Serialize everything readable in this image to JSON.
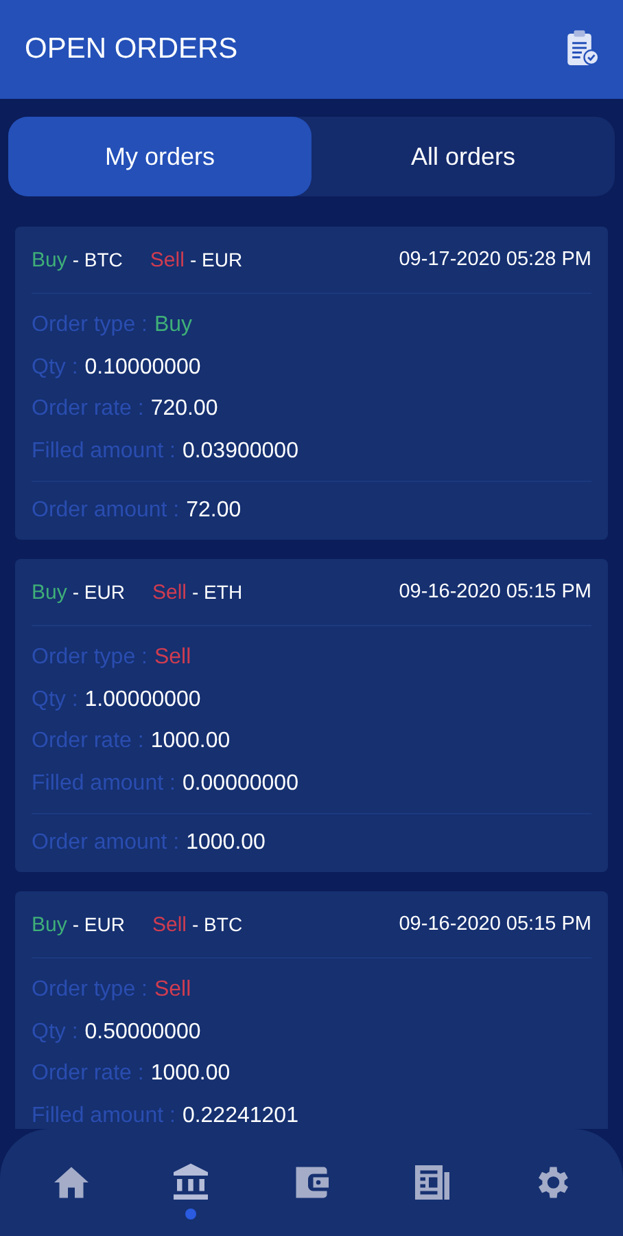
{
  "header": {
    "title": "OPEN ORDERS"
  },
  "tabs": [
    {
      "label": "My orders",
      "selected": true
    },
    {
      "label": "All orders",
      "selected": false
    }
  ],
  "orders": [
    {
      "buy_label": "Buy",
      "buy_currency": "- BTC",
      "sell_label": "Sell",
      "sell_currency": "- EUR",
      "date": "09-17-2020 05:28 PM",
      "rows": [
        {
          "label": "Order type :",
          "value": "Buy",
          "kind": "buy"
        },
        {
          "label": "Qty :",
          "value": "0.10000000",
          "kind": "plain"
        },
        {
          "label": "Order rate :",
          "value": "720.00",
          "kind": "plain"
        },
        {
          "label": "Filled amount :",
          "value": "0.03900000",
          "kind": "plain"
        }
      ],
      "total": {
        "label": "Order amount :",
        "value": "72.00"
      }
    },
    {
      "buy_label": "Buy",
      "buy_currency": "- EUR",
      "sell_label": "Sell",
      "sell_currency": "- ETH",
      "date": "09-16-2020 05:15 PM",
      "rows": [
        {
          "label": "Order type :",
          "value": "Sell",
          "kind": "sell"
        },
        {
          "label": "Qty :",
          "value": "1.00000000",
          "kind": "plain"
        },
        {
          "label": "Order rate :",
          "value": "1000.00",
          "kind": "plain"
        },
        {
          "label": "Filled amount :",
          "value": "0.00000000",
          "kind": "plain"
        }
      ],
      "total": {
        "label": "Order amount :",
        "value": "1000.00"
      }
    },
    {
      "buy_label": "Buy",
      "buy_currency": "- EUR",
      "sell_label": "Sell",
      "sell_currency": "- BTC",
      "date": "09-16-2020 05:15 PM",
      "rows": [
        {
          "label": "Order type :",
          "value": "Sell",
          "kind": "sell"
        },
        {
          "label": "Qty :",
          "value": "0.50000000",
          "kind": "plain"
        },
        {
          "label": "Order rate :",
          "value": "1000.00",
          "kind": "plain"
        },
        {
          "label": "Filled amount :",
          "value": "0.22241201",
          "kind": "plain"
        }
      ]
    }
  ],
  "nav": [
    {
      "selected": false
    },
    {
      "selected": true
    },
    {
      "selected": false
    },
    {
      "selected": false
    },
    {
      "selected": false
    }
  ]
}
